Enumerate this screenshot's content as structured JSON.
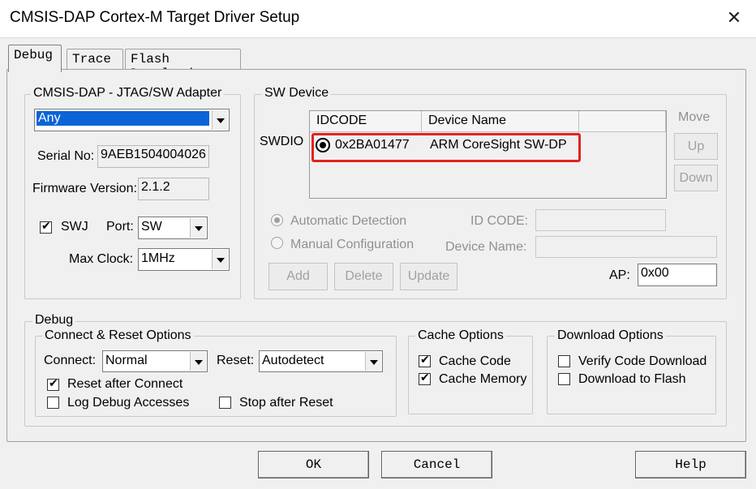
{
  "window": {
    "title": "CMSIS-DAP Cortex-M Target Driver Setup",
    "close_glyph": "✕"
  },
  "tabs": [
    {
      "label": "Debug",
      "active": true
    },
    {
      "label": "Trace",
      "active": false
    },
    {
      "label": "Flash Download",
      "active": false
    }
  ],
  "adapter": {
    "group_label": "CMSIS-DAP - JTAG/SW Adapter",
    "selected": "Any",
    "serial_label": "Serial No:",
    "serial_value": "9AEB1504004026",
    "firmware_label": "Firmware Version:",
    "firmware_value": "2.1.2",
    "swj_label": "SWJ",
    "swj_checked": true,
    "port_label": "Port:",
    "port_value": "SW",
    "maxclock_label": "Max Clock:",
    "maxclock_value": "1MHz"
  },
  "sw_device": {
    "group_label": "SW Device",
    "row_label": "SWDIO",
    "col_idcode": "IDCODE",
    "col_device": "Device Name",
    "rows": [
      {
        "idcode": "0x2BA01477",
        "device": "ARM CoreSight SW-DP"
      }
    ],
    "highlight_color": "#e0241e",
    "move_label": "Move",
    "up_label": "Up",
    "down_label": "Down",
    "auto_label": "Automatic Detection",
    "manual_label": "Manual Configuration",
    "idcode_label": "ID CODE:",
    "devname_label": "Device Name:",
    "add_label": "Add",
    "delete_label": "Delete",
    "update_label": "Update",
    "ap_label": "AP:",
    "ap_value": "0x00"
  },
  "debug": {
    "group_label": "Debug",
    "connect_group_label": "Connect & Reset Options",
    "connect_label": "Connect:",
    "connect_value": "Normal",
    "reset_label": "Reset:",
    "reset_value": "Autodetect",
    "reset_after_connect_label": "Reset after Connect",
    "reset_after_connect_checked": true,
    "log_debug_label": "Log Debug Accesses",
    "log_debug_checked": false,
    "stop_after_reset_label": "Stop after Reset",
    "stop_after_reset_checked": false,
    "cache_group_label": "Cache Options",
    "cache_code_label": "Cache Code",
    "cache_code_checked": true,
    "cache_memory_label": "Cache Memory",
    "cache_memory_checked": true,
    "download_group_label": "Download Options",
    "verify_label": "Verify Code Download",
    "verify_checked": false,
    "download_flash_label": "Download to Flash",
    "download_flash_checked": false
  },
  "footer": {
    "ok_label": "OK",
    "cancel_label": "Cancel",
    "help_label": "Help"
  }
}
